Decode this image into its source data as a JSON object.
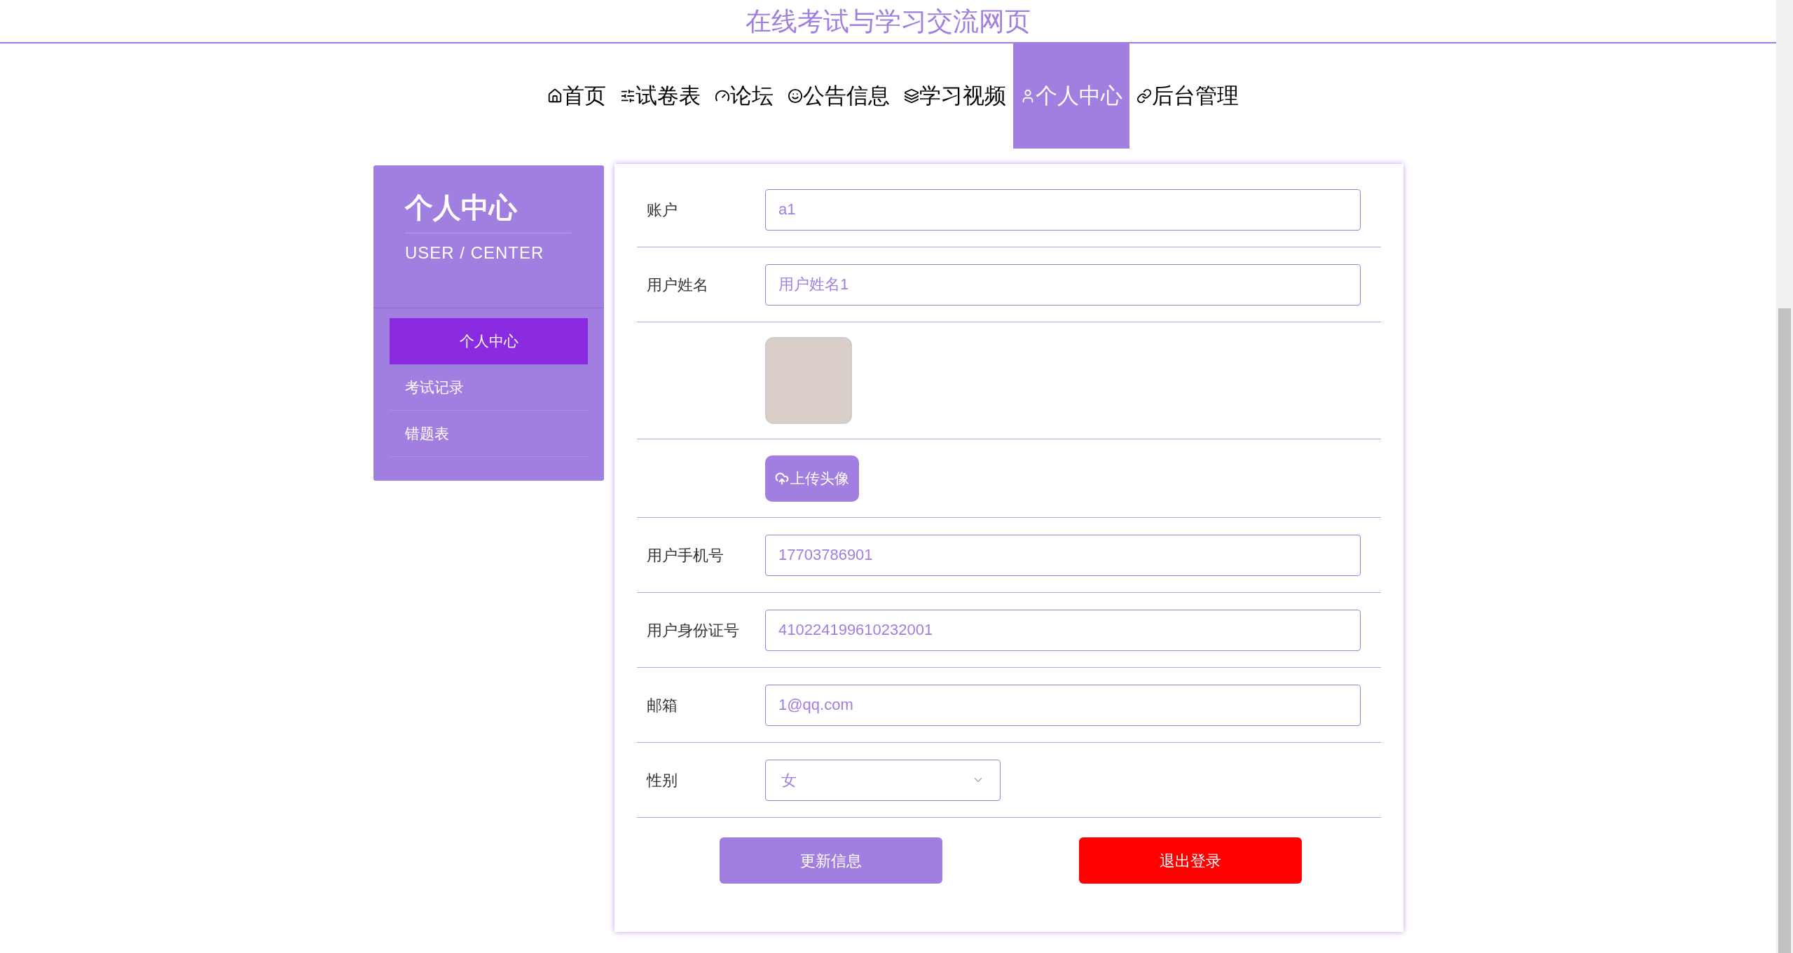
{
  "site_title": "在线考试与学习交流网页",
  "nav": [
    {
      "label": "首页",
      "selected": false
    },
    {
      "label": "试卷表",
      "selected": false
    },
    {
      "label": "论坛",
      "selected": false
    },
    {
      "label": "公告信息",
      "selected": false
    },
    {
      "label": "学习视频",
      "selected": false
    },
    {
      "label": "个人中心",
      "selected": true
    },
    {
      "label": "后台管理",
      "selected": false
    }
  ],
  "sidebar": {
    "title": "个人中心",
    "subtitle": "USER / CENTER",
    "items": [
      {
        "label": "个人中心",
        "selected": true
      },
      {
        "label": "考试记录",
        "selected": false
      },
      {
        "label": "错题表",
        "selected": false
      }
    ]
  },
  "form": {
    "rows": [
      {
        "kind": "text",
        "label": "账户",
        "value": "a1"
      },
      {
        "kind": "text",
        "label": "用户姓名",
        "value": "用户姓名1"
      },
      {
        "kind": "avatar"
      },
      {
        "kind": "upload",
        "button": "上传头像"
      },
      {
        "kind": "text",
        "label": "用户手机号",
        "value": "17703786901"
      },
      {
        "kind": "text",
        "label": "用户身份证号",
        "value": "410224199610232001"
      },
      {
        "kind": "text",
        "label": "邮箱",
        "value": "1@qq.com"
      },
      {
        "kind": "select",
        "label": "性别",
        "value": "女"
      }
    ],
    "buttons": [
      {
        "kind": "primary",
        "label": "更新信息"
      },
      {
        "kind": "danger",
        "label": "退出登录"
      }
    ]
  }
}
